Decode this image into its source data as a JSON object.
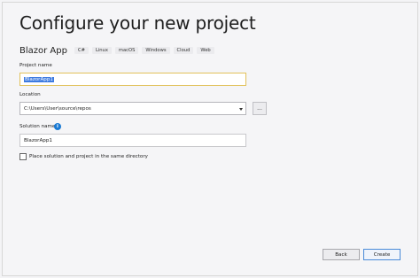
{
  "header": {
    "title": "Configure your new project"
  },
  "template": {
    "name": "Blazor App",
    "tags": [
      "C#",
      "Linux",
      "macOS",
      "Windows",
      "Cloud",
      "Web"
    ]
  },
  "project_name": {
    "label": "Project name",
    "value": "BlazorApp1"
  },
  "location": {
    "label": "Location",
    "value": "C:\\Users\\User\\source\\repos",
    "browse_label": "..."
  },
  "solution_name": {
    "label": "Solution name",
    "info_icon": "info-icon",
    "value": "BlazorApp1"
  },
  "same_directory": {
    "label": "Place solution and project in the same directory",
    "checked": false
  },
  "footer": {
    "back_label": "Back",
    "create_label": "Create"
  },
  "colors": {
    "accent": "#3d7be0",
    "focus_border": "#e2c15a",
    "info": "#1a7ad4"
  }
}
